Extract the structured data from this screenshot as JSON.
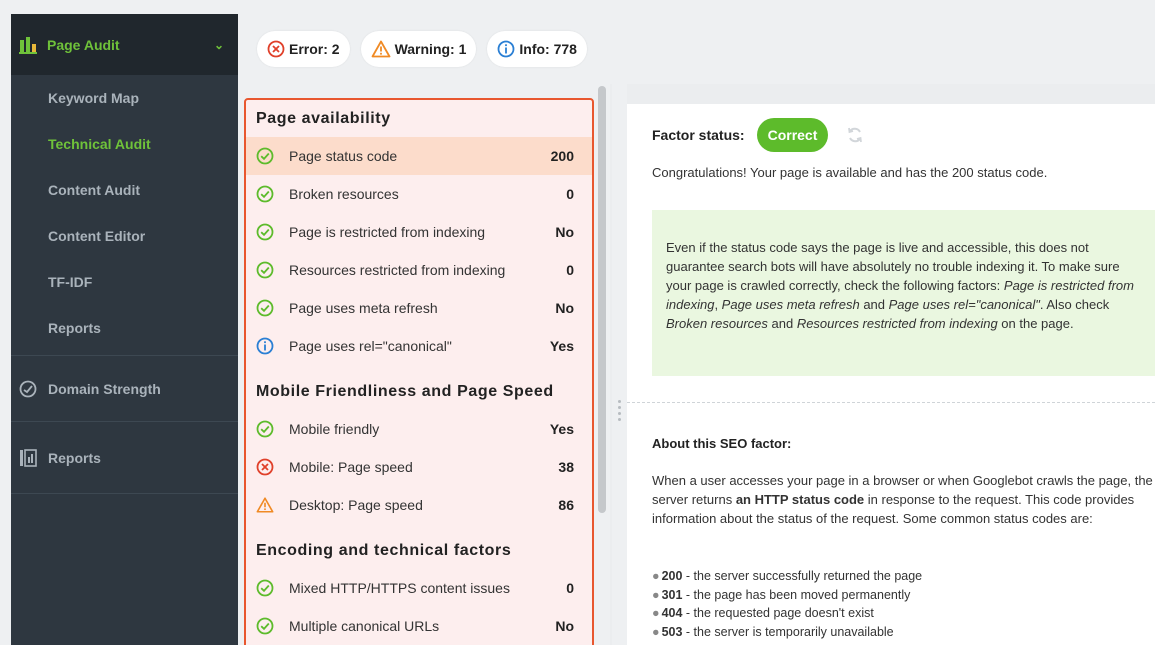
{
  "sidebar": {
    "header_label": "Page Audit",
    "sub_items": [
      {
        "label": "Keyword Map",
        "active": false
      },
      {
        "label": "Technical Audit",
        "active": true
      },
      {
        "label": "Content Audit",
        "active": false
      },
      {
        "label": "Content Editor",
        "active": false
      },
      {
        "label": "TF-IDF",
        "active": false
      },
      {
        "label": "Reports",
        "active": false
      }
    ],
    "domain_strength_label": "Domain Strength",
    "reports_label": "Reports"
  },
  "toolbar": {
    "error_label": "Error: 2",
    "warning_label": "Warning: 1",
    "info_label": "Info: 778"
  },
  "factors": {
    "sections": [
      {
        "title": "Page availability",
        "rows": [
          {
            "status": "ok",
            "label": "Page status code",
            "value": "200",
            "selected": true
          },
          {
            "status": "ok",
            "label": "Broken resources",
            "value": "0"
          },
          {
            "status": "ok",
            "label": "Page is restricted from indexing",
            "value": "No"
          },
          {
            "status": "ok",
            "label": "Resources restricted from indexing",
            "value": "0"
          },
          {
            "status": "ok",
            "label": "Page uses meta refresh",
            "value": "No"
          },
          {
            "status": "info",
            "label": "Page uses rel=\"canonical\"",
            "value": "Yes"
          }
        ]
      },
      {
        "title": "Mobile Friendliness and Page Speed",
        "rows": [
          {
            "status": "ok",
            "label": "Mobile friendly",
            "value": "Yes"
          },
          {
            "status": "error",
            "label": "Mobile: Page speed",
            "value": "38"
          },
          {
            "status": "warning",
            "label": "Desktop: Page speed",
            "value": "86"
          }
        ]
      },
      {
        "title": "Encoding and technical factors",
        "rows": [
          {
            "status": "ok",
            "label": "Mixed HTTP/HTTPS content issues",
            "value": "0"
          },
          {
            "status": "ok",
            "label": "Multiple canonical URLs",
            "value": "No"
          }
        ]
      }
    ]
  },
  "detail": {
    "factor_status_label": "Factor status:",
    "status_badge": "Correct",
    "congrats": "Congratulations! Your page is available and has the 200 status code.",
    "note_parts": [
      {
        "t": "Even if the status code says the page is live and accessible, this does not guarantee search bots will have absolutely no trouble indexing it. To make sure your page is crawled correctly, check the following factors: ",
        "i": false
      },
      {
        "t": "Page is restricted from indexing",
        "i": true
      },
      {
        "t": ", ",
        "i": false
      },
      {
        "t": "Page uses meta refresh",
        "i": true
      },
      {
        "t": " and ",
        "i": false
      },
      {
        "t": "Page uses rel=\"canonical\"",
        "i": true
      },
      {
        "t": ". Also check ",
        "i": false
      },
      {
        "t": "Broken resources",
        "i": true
      },
      {
        "t": " and ",
        "i": false
      },
      {
        "t": "Resources restricted from indexing",
        "i": true
      },
      {
        "t": " on the page.",
        "i": false
      }
    ],
    "about_title": "About this SEO factor:",
    "about_before": "When a user accesses your page in a browser or when Googlebot crawls the page, the server returns ",
    "about_bold": "an HTTP status code",
    "about_after": " in response to the request. This code provides information about the status of the request. Some common status codes are:",
    "codes": [
      {
        "code": "200",
        "desc": " - the server successfully returned the page"
      },
      {
        "code": "301",
        "desc": " - the page has been moved permanently"
      },
      {
        "code": "404",
        "desc": " - the requested page doesn't exist"
      },
      {
        "code": "503",
        "desc": " - the server is temporarily unavailable"
      }
    ]
  },
  "colors": {
    "accent_green": "#6fc23a",
    "badge_green": "#5dbb2b",
    "error_red": "#e0402a",
    "warning_orange": "#f08a24",
    "info_blue": "#2a7fd4",
    "panel_border": "#e8572f"
  }
}
